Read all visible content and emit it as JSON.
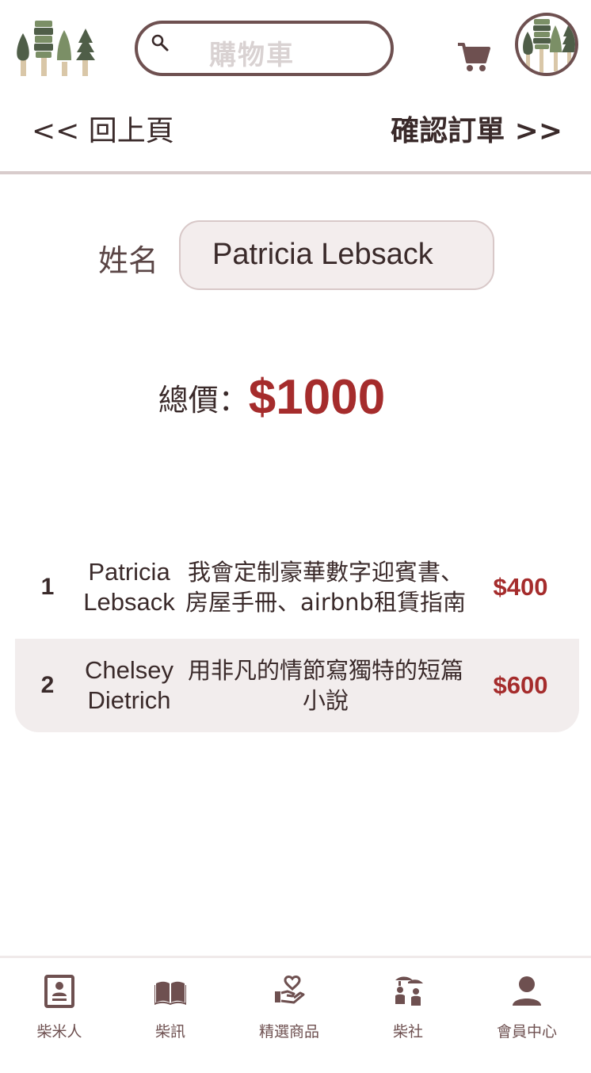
{
  "header": {
    "search_placeholder": "購物車",
    "logo_icon": "trees-logo-icon",
    "cart_icon": "cart-icon",
    "avatar_icon": "trees-avatar-icon"
  },
  "nav": {
    "back_label": "<< 回上頁",
    "confirm_label": "確認訂單 >>"
  },
  "form": {
    "name_label": "姓名",
    "name_value": "Patricia Lebsack"
  },
  "summary": {
    "total_label": "總價：",
    "total_value": "$1000"
  },
  "orders": [
    {
      "index": "1",
      "name": "Patricia Lebsack",
      "title": "我會定制豪華數字迎賓書、房屋手冊、airbnb租賃指南",
      "price": "$400"
    },
    {
      "index": "2",
      "name": "Chelsey Dietrich",
      "title": "用非凡的情節寫獨特的短篇小說",
      "price": "$600"
    }
  ],
  "tabbar": [
    {
      "label": "柴米人",
      "icon": "id-card-icon"
    },
    {
      "label": "柴訊",
      "icon": "book-icon"
    },
    {
      "label": "精選商品",
      "icon": "hand-heart-icon"
    },
    {
      "label": "柴社",
      "icon": "group-icon"
    },
    {
      "label": "會員中心",
      "icon": "user-icon"
    }
  ],
  "colors": {
    "brand_brown": "#6e5050",
    "price_red": "#a52c2c",
    "row_alt_bg": "#f2eded",
    "tree_dark": "#4f5e48",
    "tree_green": "#7b8f66",
    "trunk": "#d9c7a8"
  }
}
